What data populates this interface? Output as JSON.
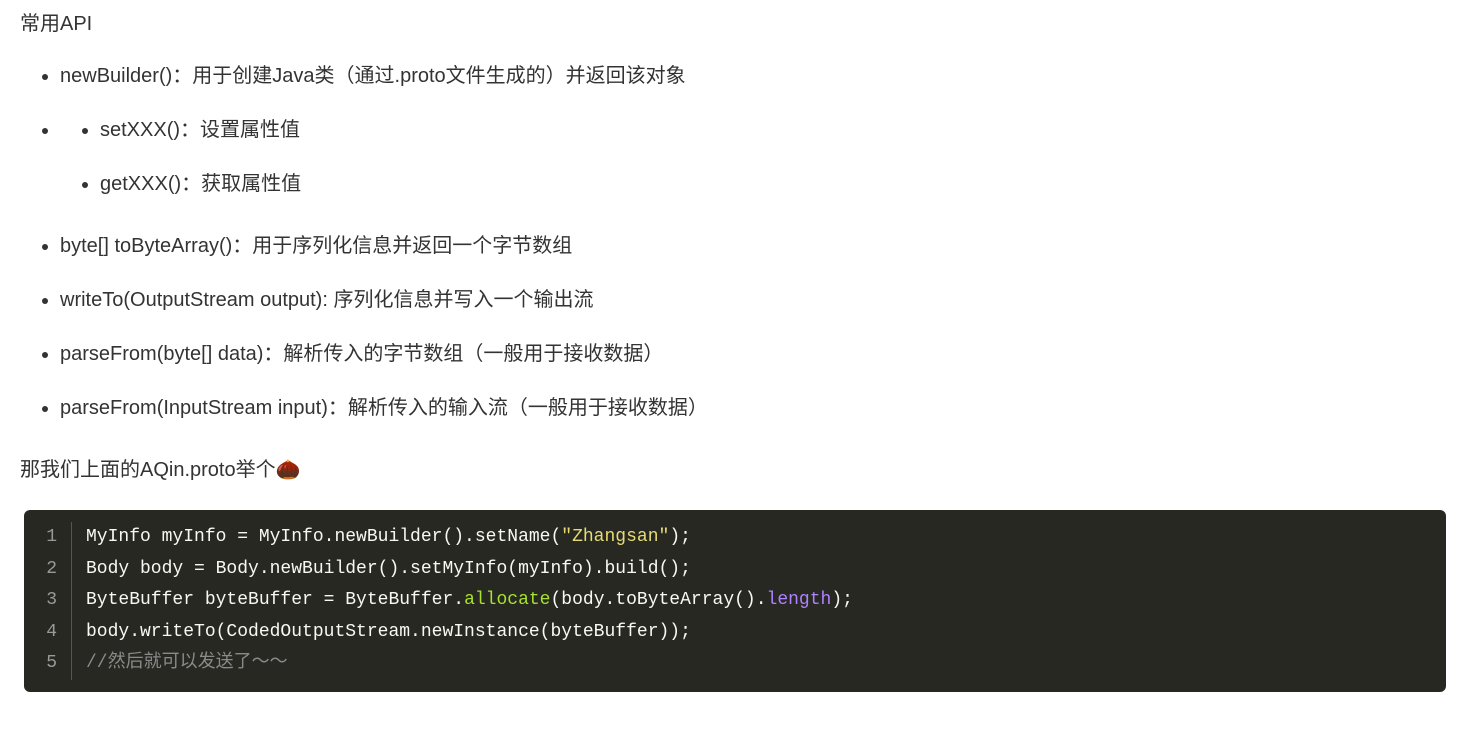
{
  "heading": "常用API",
  "list_top": [
    "newBuilder()：用于创建Java类（通过.proto文件生成的）并返回该对象"
  ],
  "list_inner": [
    "setXXX()：设置属性值",
    "getXXX()：获取属性值"
  ],
  "list_bottom": [
    "byte[] toByteArray()：用于序列化信息并返回一个字节数组",
    "writeTo(OutputStream output): 序列化信息并写入一个输出流",
    "parseFrom(byte[] data)：解析传入的字节数组（一般用于接收数据）",
    "parseFrom(InputStream input)：解析传入的输入流（一般用于接收数据）"
  ],
  "paragraph": "那我们上面的AQin.proto举个🌰",
  "code": {
    "lines": [
      {
        "n": "1",
        "pre": "MyInfo myInfo = MyInfo.newBuilder().setName(",
        "str": "\"Zhangsan\"",
        "post": ");"
      },
      {
        "n": "2",
        "plain": "Body body = Body.newBuilder().setMyInfo(myInfo).build();"
      },
      {
        "n": "3",
        "pre": "ByteBuffer byteBuffer = ByteBuffer.",
        "fn": "allocate",
        "mid": "(body.toByteArray().",
        "prop": "length",
        "post": ");"
      },
      {
        "n": "4",
        "plain": "body.writeTo(CodedOutputStream.newInstance(byteBuffer));"
      },
      {
        "n": "5",
        "comment": "//然后就可以发送了～～"
      }
    ]
  }
}
